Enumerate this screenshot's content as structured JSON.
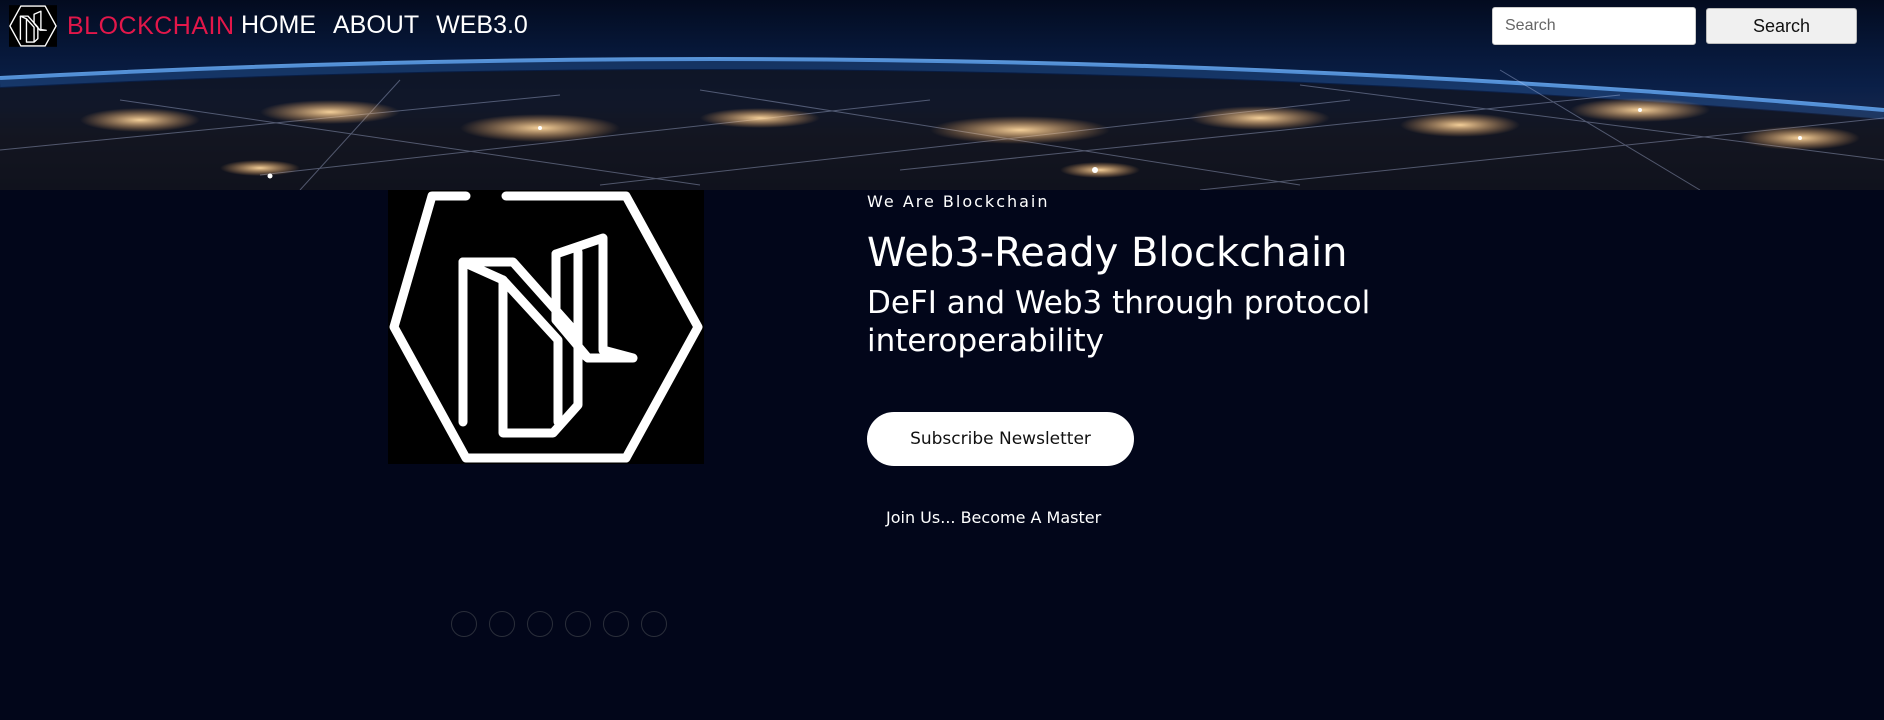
{
  "navbar": {
    "brand_logo_icon": "blockchain-hexagon-logo-icon",
    "brand_name": "BLOCKCHAIN",
    "brand_color": "#e2174a",
    "links": [
      {
        "label": "HOME"
      },
      {
        "label": "ABOUT"
      },
      {
        "label": "WEB3.0"
      }
    ],
    "search": {
      "placeholder": "Search",
      "value": "",
      "button_label": "Search"
    }
  },
  "hero": {
    "banner_image": "earth-night-network-icon",
    "logo_icon": "blockchain-hexagon-logo-icon",
    "kicker": "We Are Blockchain",
    "headline": "Web3-Ready Blockchain",
    "subheadline": "DeFI and Web3 through protocol interoperability",
    "subscribe_label": "Subscribe Newsletter",
    "join_text": "Join Us... Become A Master",
    "background_color": "#02061a"
  },
  "carousel": {
    "dot_count": 6
  }
}
